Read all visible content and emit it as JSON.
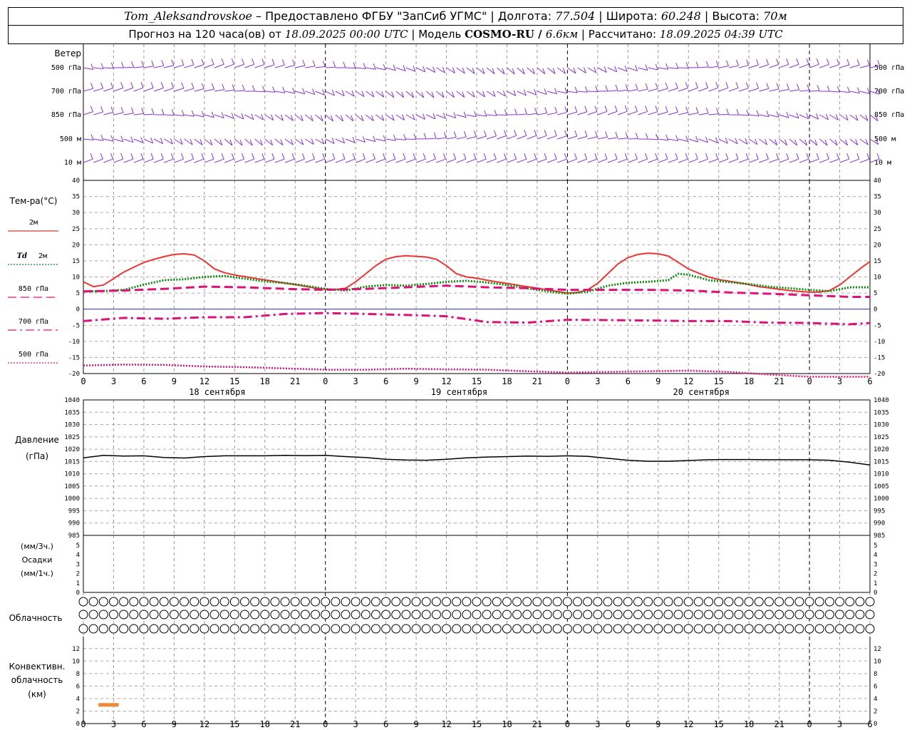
{
  "header": {
    "station": "Tom_Aleksandrovskoe",
    "provider": " – Предоставлено ФГБУ \"ЗапСиб УГМС\" | Долгота: ",
    "lon": "77.504",
    "lat_label": " | Широта: ",
    "lat": "60.248",
    "alt_label": " | Высота: ",
    "alt": "70м",
    "forecast_label": "Прогноз на 120 часа(ов) от ",
    "forecast_start": "18.09.2025 00:00 UTC",
    "model_label": "  | Модель ",
    "model": "COSMO-RU / ",
    "resolution": "6.6км",
    "calc_label": " | Рассчитано: ",
    "calc_time": "18.09.2025 04:39 UTC"
  },
  "labels": {
    "wind": "Ветер",
    "wind_levels": [
      "500 гПа",
      "700 гПа",
      "850 гПа",
      "500 м",
      "10 м"
    ],
    "temp": "Тем-ра(°C)",
    "t2m": "2м",
    "td": "Td",
    "td2": "2м",
    "t850": "850 гПа",
    "t700": "700 гПа",
    "t500": "500 гПа",
    "pressure": "Давление",
    "pressure_unit": "(гПа)",
    "precip_a": "(мм/3ч.)",
    "precip_b": "Осадки",
    "precip_c": "(мм/1ч.)",
    "cloud": "Облачность",
    "conv_a": "Конвективн.",
    "conv_b": "облачность",
    "conv_c": "(км)"
  },
  "colors": {
    "t2m": "#ee3333",
    "td": "#118811",
    "t850": "#dd1177",
    "t700": "#dd1177",
    "t500": "#dd1177",
    "wind": "#8833cc",
    "conv": "#ee8833",
    "zero": "#3333cc"
  },
  "chart_data": [
    {
      "type": "line",
      "name": "temperature",
      "ylim": [
        -20,
        40
      ],
      "yticks": [
        -20,
        -15,
        -10,
        -5,
        0,
        5,
        10,
        15,
        20,
        25,
        30,
        35,
        40
      ],
      "x_hours": [
        0,
        3,
        6,
        9,
        12,
        15,
        18,
        21,
        24,
        27,
        30,
        33,
        36,
        39,
        42,
        45,
        48,
        51,
        54,
        57,
        60,
        63,
        66,
        69,
        72,
        75,
        78
      ],
      "x_tick_labels": [
        "0",
        "3",
        "6",
        "9",
        "12",
        "15",
        "18",
        "21",
        "0",
        "3",
        "6",
        "9",
        "12",
        "15",
        "18",
        "21",
        "0",
        "3",
        "6",
        "9",
        "12",
        "15",
        "18",
        "21",
        "0",
        "3",
        "6"
      ],
      "day_labels": [
        "18 сентября",
        "19 сентября",
        "20 сентября"
      ],
      "series": [
        {
          "name": "2м",
          "key": "t2m",
          "x": [
            0,
            1,
            2,
            3,
            4,
            5,
            6,
            7,
            8,
            9,
            10,
            11,
            12,
            13,
            14,
            15,
            16,
            17,
            18,
            19,
            20,
            21,
            22,
            23,
            24,
            25,
            26,
            27,
            28,
            29,
            30,
            31,
            32,
            33,
            34,
            35,
            36,
            37,
            38,
            39,
            40,
            41,
            42,
            43,
            44,
            45,
            46,
            47,
            48,
            49,
            50,
            51,
            52,
            53,
            54,
            55,
            56,
            57,
            58,
            59,
            60,
            61,
            62,
            63,
            64,
            65,
            66,
            67,
            68,
            69,
            70,
            71,
            72,
            73,
            74,
            75,
            76,
            77,
            78
          ],
          "y": [
            8.5,
            7,
            7.5,
            9.5,
            11.5,
            13,
            14.5,
            15.5,
            16.3,
            17,
            17.2,
            16.8,
            15,
            12.5,
            11.3,
            10.6,
            10.1,
            9.6,
            9.1,
            8.6,
            8.1,
            7.6,
            7.1,
            6.5,
            6.2,
            6.1,
            6.5,
            8.5,
            11,
            13.5,
            15.5,
            16.3,
            16.6,
            16.4,
            16.2,
            15.5,
            13.5,
            11,
            10,
            9.6,
            9,
            8.5,
            8,
            7.5,
            7,
            6.5,
            6,
            5.5,
            5,
            5.2,
            6,
            8,
            11,
            14,
            16,
            17,
            17.4,
            17.2,
            16.5,
            14.5,
            12.5,
            11.2,
            10,
            9.2,
            8.7,
            8.2,
            7.6,
            7,
            6.6,
            6.2,
            5.8,
            5.5,
            5.3,
            5.3,
            5.8,
            7.5,
            10,
            12.5,
            14.8
          ]
        },
        {
          "name": "Td 2м",
          "key": "td",
          "x": [
            0,
            2,
            4,
            6,
            8,
            10,
            12,
            14,
            16,
            18,
            20,
            22,
            24,
            26,
            28,
            30,
            32,
            34,
            36,
            38,
            40,
            42,
            44,
            46,
            48,
            50,
            52,
            54,
            56,
            58,
            59,
            60,
            62,
            64,
            66,
            68,
            70,
            72,
            74,
            76,
            78
          ],
          "y": [
            5.5,
            5.6,
            6,
            7.6,
            9,
            9.3,
            10,
            10.3,
            9.5,
            8.6,
            8.1,
            7.3,
            6.3,
            5.8,
            7,
            7.5,
            7.3,
            7.8,
            8.5,
            8.8,
            8.3,
            7.5,
            6.5,
            5.5,
            4.8,
            5.4,
            7.3,
            8.2,
            8.5,
            9,
            11,
            10.7,
            9,
            8.4,
            7.8,
            7,
            6.5,
            6,
            5.6,
            6.8,
            6.8
          ]
        },
        {
          "name": "850 гПа",
          "key": "t850",
          "x": [
            0,
            4,
            8,
            12,
            16,
            20,
            24,
            28,
            32,
            36,
            40,
            44,
            48,
            52,
            56,
            60,
            64,
            68,
            72,
            76,
            78
          ],
          "y": [
            5.5,
            5.8,
            6.3,
            7,
            6.8,
            6.3,
            6,
            6.3,
            6.8,
            7.3,
            6.8,
            6.5,
            6,
            6,
            6,
            5.8,
            5.2,
            4.8,
            4.3,
            3.8,
            3.8
          ]
        },
        {
          "name": "700 гПа",
          "key": "t700",
          "x": [
            0,
            4,
            8,
            12,
            16,
            20,
            24,
            28,
            32,
            36,
            40,
            44,
            48,
            52,
            56,
            60,
            64,
            68,
            72,
            76,
            78
          ],
          "y": [
            -3.7,
            -2.7,
            -3,
            -2.5,
            -2.5,
            -1.5,
            -1.2,
            -1.5,
            -1.8,
            -2.2,
            -4,
            -4.2,
            -3.3,
            -3.4,
            -3.5,
            -3.7,
            -3.7,
            -4.2,
            -4.3,
            -4.7,
            -4.3
          ]
        },
        {
          "name": "500 гПа",
          "key": "t500",
          "x": [
            0,
            4,
            8,
            12,
            16,
            20,
            24,
            28,
            32,
            36,
            40,
            44,
            48,
            52,
            56,
            60,
            64,
            68,
            72,
            76,
            78
          ],
          "y": [
            -17.5,
            -17.2,
            -17.3,
            -17.8,
            -18,
            -18.4,
            -18.8,
            -18.8,
            -18.5,
            -18.7,
            -18.8,
            -19.3,
            -19.7,
            -19.5,
            -19.3,
            -19.1,
            -19.5,
            -20.3,
            -21,
            -21,
            -21
          ]
        }
      ]
    },
    {
      "type": "line",
      "name": "pressure",
      "ylim": [
        985,
        1040
      ],
      "yticks": [
        985,
        990,
        995,
        1000,
        1005,
        1010,
        1015,
        1020,
        1025,
        1030,
        1035,
        1040
      ],
      "series": [
        {
          "name": "Давление",
          "key": "p",
          "x": [
            0,
            2,
            4,
            6,
            8,
            10,
            12,
            14,
            16,
            18,
            20,
            22,
            24,
            26,
            28,
            30,
            32,
            34,
            36,
            38,
            40,
            42,
            44,
            46,
            48,
            50,
            52,
            54,
            56,
            58,
            60,
            62,
            64,
            66,
            68,
            70,
            72,
            74,
            76,
            78
          ],
          "y": [
            1016.5,
            1017.5,
            1017.2,
            1017.3,
            1016.6,
            1016.4,
            1017,
            1017.3,
            1017.3,
            1017.3,
            1017.5,
            1017.4,
            1017.5,
            1017,
            1016.6,
            1015.9,
            1015.6,
            1015.5,
            1015.9,
            1016.5,
            1016.8,
            1017,
            1017.2,
            1017.1,
            1017.3,
            1017.1,
            1016.3,
            1015.5,
            1015.1,
            1015.1,
            1015.4,
            1015.7,
            1015.8,
            1015.8,
            1015.7,
            1015.7,
            1015.7,
            1015.5,
            1014.7,
            1013.6
          ]
        }
      ]
    },
    {
      "type": "bar",
      "name": "precipitation",
      "ylim": [
        0,
        5
      ],
      "yticks": [
        0,
        1,
        2,
        3,
        4,
        5
      ],
      "values": []
    },
    {
      "type": "bar",
      "name": "convective_cloud",
      "ylim": [
        0,
        13
      ],
      "yticks": [
        0,
        2,
        4,
        6,
        8,
        10,
        12
      ],
      "segments": [
        {
          "x_start": 1.5,
          "x_end": 3.5,
          "y": 3
        }
      ]
    }
  ]
}
